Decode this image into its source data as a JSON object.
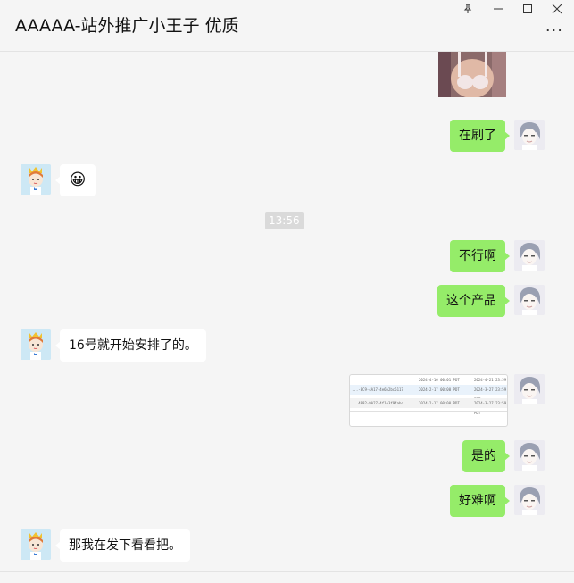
{
  "window": {
    "title": "AAAAA-站外推广小王子 优质",
    "pin_icon": "pin-icon",
    "minimize_icon": "minimize-icon",
    "maximize_icon": "maximize-icon",
    "close_icon": "close-icon",
    "more_icon": "more-icon"
  },
  "messages": [
    {
      "side": "me",
      "type": "image",
      "content": "photo"
    },
    {
      "side": "me",
      "type": "text",
      "text": "在刷了"
    },
    {
      "side": "other",
      "type": "emoji",
      "text": "😀"
    },
    {
      "side": "system",
      "type": "time",
      "text": "13:56"
    },
    {
      "side": "me",
      "type": "text",
      "text": "不行啊"
    },
    {
      "side": "me",
      "type": "text",
      "text": "这个产品"
    },
    {
      "side": "other",
      "type": "text",
      "text": "16号就开始安排了的。"
    },
    {
      "side": "me",
      "type": "image",
      "content": "screenshot"
    },
    {
      "side": "me",
      "type": "text",
      "text": "是的"
    },
    {
      "side": "me",
      "type": "text",
      "text": "好难啊"
    },
    {
      "side": "other",
      "type": "text",
      "text": "那我在发下看看把。"
    }
  ],
  "screenshot_rows": [
    {
      "id": "",
      "date1": "2024-4-16 00:01 PDT",
      "date2": "2024-4-21 23:59 PDT"
    },
    {
      "id": "...-8C9-4A17-4e6b2bc6117",
      "date1": "2024-2-17 00:00 PDT",
      "date2": "2024-3-27 23:59 PDT"
    },
    {
      "id": "...4892-9A27-4f1e3f9fabc",
      "date1": "2024-2-17 00:00 PDT",
      "date2": "2024-3-27 23:59 PDT"
    }
  ],
  "colors": {
    "my_bubble": "#95ec69",
    "other_bubble": "#ffffff",
    "background": "#f5f5f5"
  }
}
